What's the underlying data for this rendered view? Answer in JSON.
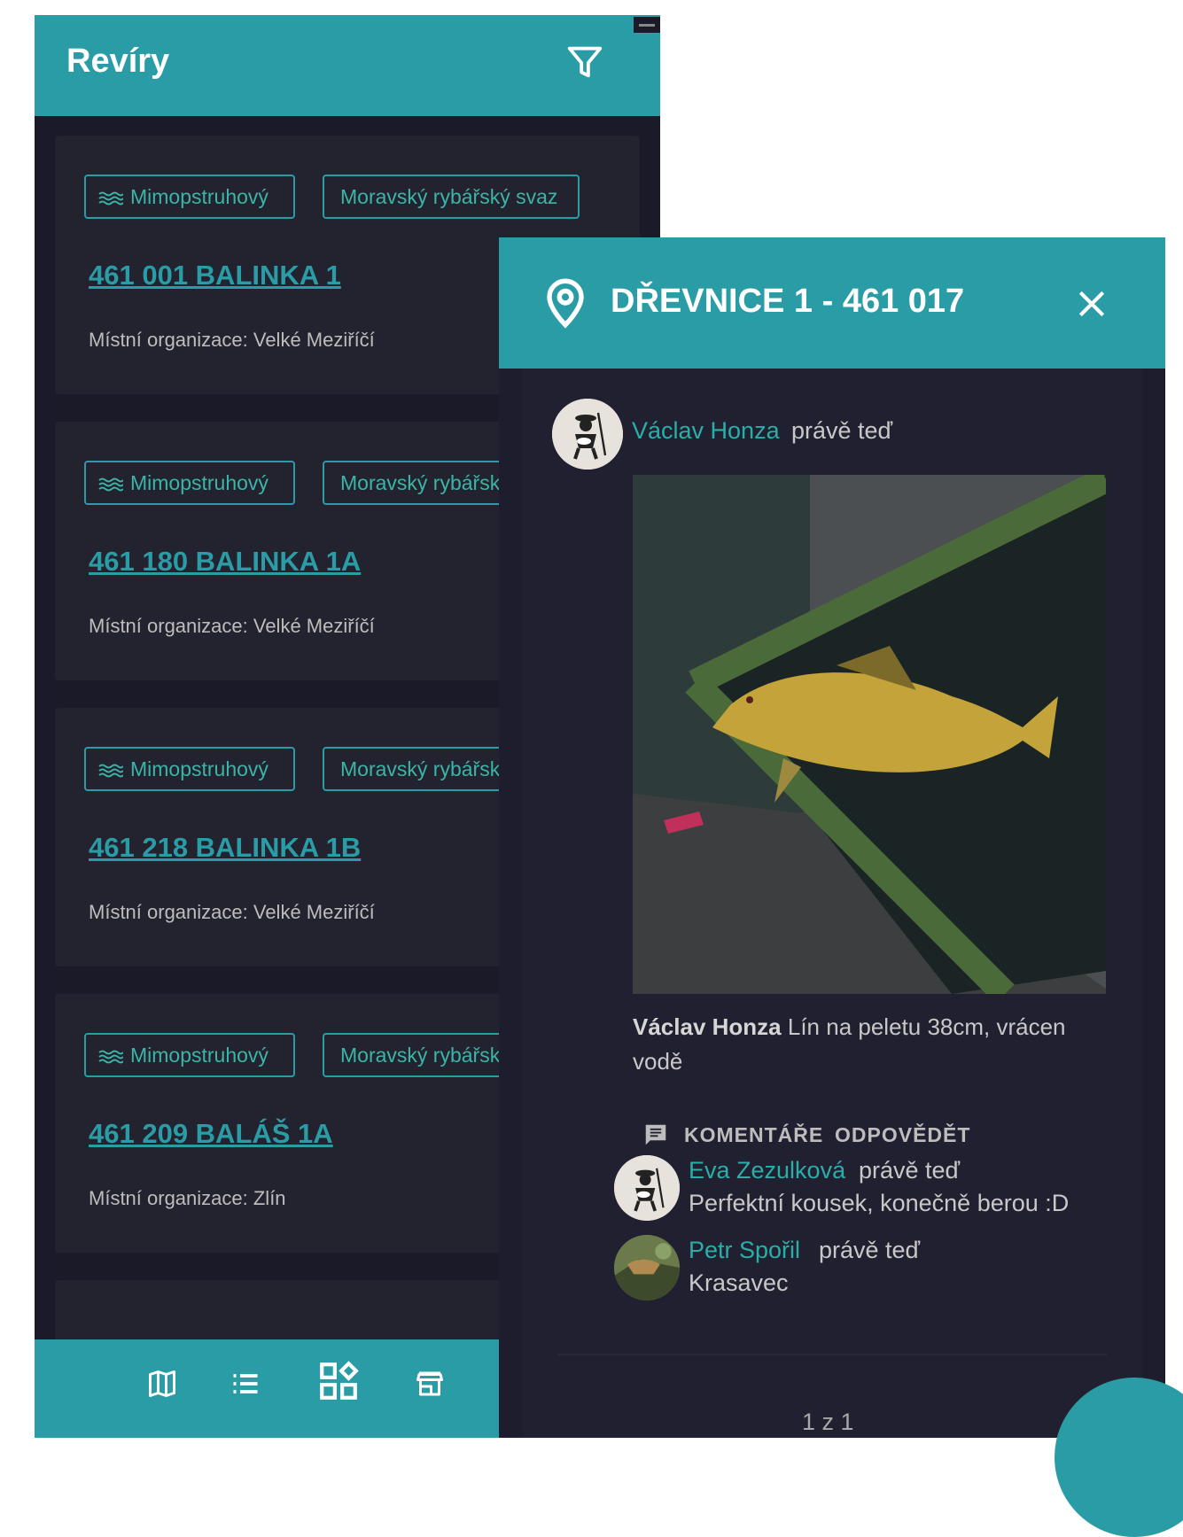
{
  "left": {
    "title": "Revíry",
    "icons": {
      "filter": "filter-icon",
      "chip": "waves-icon"
    },
    "cards": [
      {
        "type_chip": "Mimopstruhový",
        "org_chip": "Moravský rybářský svaz",
        "title": "461 001 BALINKA 1",
        "org": "Místní organizace: Velké Meziříčí"
      },
      {
        "type_chip": "Mimopstruhový",
        "org_chip": "Moravský rybářský svaz",
        "title": "461 180 BALINKA 1A",
        "org": "Místní organizace: Velké Meziříčí"
      },
      {
        "type_chip": "Mimopstruhový",
        "org_chip": "Moravský rybářský svaz",
        "title": "461 218 BALINKA 1B",
        "org": "Místní organizace: Velké Meziříčí"
      },
      {
        "type_chip": "Mimopstruhový",
        "org_chip": "Moravský rybářský svaz",
        "title": "461 209 BALÁŠ 1A",
        "org": "Místní organizace: Zlín"
      }
    ],
    "bottom_nav": [
      "map-icon",
      "list-icon",
      "widgets-icon",
      "store-icon"
    ]
  },
  "detail": {
    "title": "DŘEVNICE 1 - 461 017",
    "icons": {
      "location": "location-pin-icon",
      "close": "close-icon",
      "comments": "comment-icon"
    },
    "post": {
      "author": "Václav Honza",
      "time": "právě teď",
      "caption_author": "Václav Honza",
      "caption_text": "Lín na peletu 38cm, vrácen vodě",
      "photo": "fish-photo"
    },
    "actions": {
      "comments": "KOMENTÁŘE",
      "reply": "ODPOVĚDĚT"
    },
    "comments": [
      {
        "author": "Eva Zezulková",
        "time": "právě teď",
        "text": "Perfektní kousek, konečně berou :D"
      },
      {
        "author": "Petr Spořil",
        "time": "právě teď",
        "text": "Krasavec"
      }
    ],
    "pagination": "1 z 1"
  },
  "colors": {
    "accent": "#2a9ca6",
    "background": "#1b1a28",
    "card": "#23222f",
    "link": "#2aaea8"
  }
}
